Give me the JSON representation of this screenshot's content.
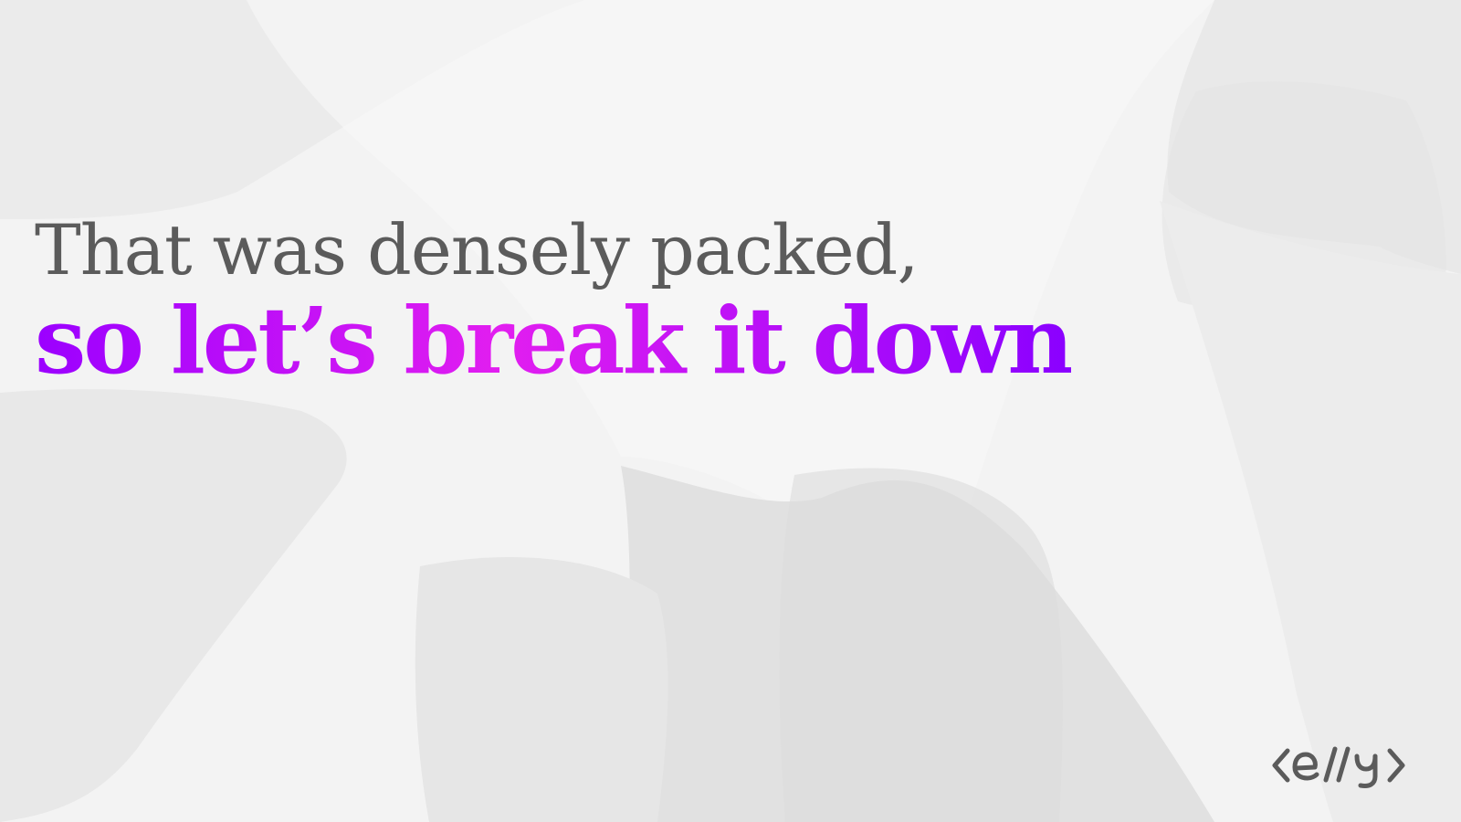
{
  "slide": {
    "line1": "That was densely packed,",
    "line2": "so let’s break it down"
  },
  "logo": {
    "text": "<e//y>",
    "icon": "elly-code-logo-icon"
  },
  "colors": {
    "background": "#f3f3f3",
    "line1": "#5b5b5b",
    "gradient_start": "#9b00ff",
    "gradient_mid": "#e21ef0",
    "gradient_end": "#8a00ff",
    "logo": "#5b5b5b"
  }
}
